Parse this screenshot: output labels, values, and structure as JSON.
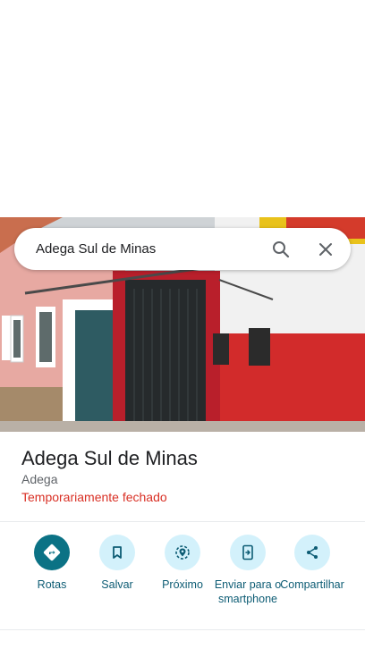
{
  "search": {
    "query": "Adega Sul de Minas"
  },
  "place": {
    "title": "Adega Sul de Minas",
    "category": "Adega",
    "status": "Temporariamente fechado",
    "status_color": "#d93025"
  },
  "actions": [
    {
      "label": "Rotas",
      "icon": "directions-icon"
    },
    {
      "label": "Salvar",
      "icon": "bookmark-icon"
    },
    {
      "label": "Próximo",
      "icon": "nearby-icon"
    },
    {
      "label": "Enviar para o smartphone",
      "icon": "send-to-phone-icon"
    },
    {
      "label": "Compartilhar",
      "icon": "share-icon"
    }
  ],
  "colors": {
    "accent": "#0b7285",
    "action_bg": "#d3f1fb",
    "action_text": "#0d5c74"
  }
}
